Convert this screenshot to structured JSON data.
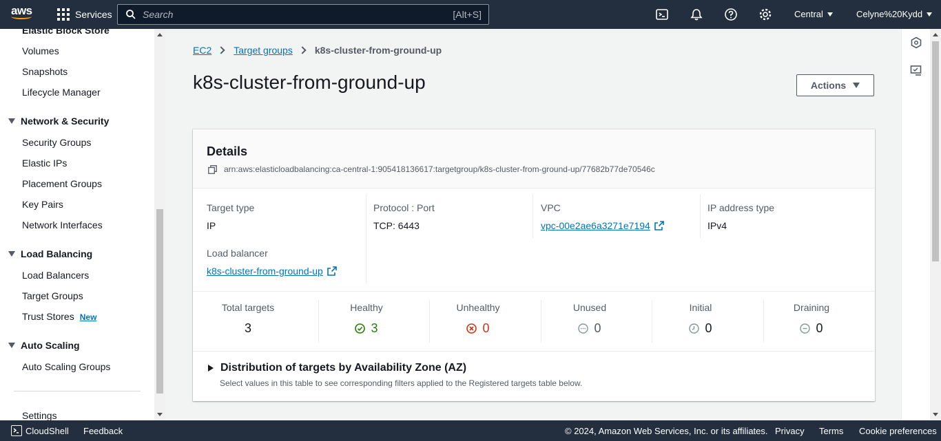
{
  "topnav": {
    "logo_text": "aws",
    "services_label": "Services",
    "search_placeholder": "Search",
    "search_shortcut": "[Alt+S]",
    "region": "Central",
    "user": "Celyne%20Kydd",
    "icons": [
      "cloudshell-icon",
      "bell-icon",
      "help-icon",
      "gear-icon"
    ]
  },
  "sidebar": {
    "partial_header": "Elastic Block Store",
    "ebs_items": [
      "Volumes",
      "Snapshots",
      "Lifecycle Manager"
    ],
    "network_section": "Network & Security",
    "network_items": [
      "Security Groups",
      "Elastic IPs",
      "Placement Groups",
      "Key Pairs",
      "Network Interfaces"
    ],
    "lb_section": "Load Balancing",
    "lb_items": [
      "Load Balancers",
      "Target Groups",
      "Trust Stores"
    ],
    "new_badge": "New",
    "as_section": "Auto Scaling",
    "as_items": [
      "Auto Scaling Groups"
    ],
    "settings": "Settings"
  },
  "breadcrumb": {
    "items": [
      "EC2",
      "Target groups"
    ],
    "current": "k8s-cluster-from-ground-up"
  },
  "page": {
    "title": "k8s-cluster-from-ground-up",
    "actions_label": "Actions"
  },
  "details": {
    "title": "Details",
    "arn": "arn:aws:elasticloadbalancing:ca-central-1:905418136617:targetgroup/k8s-cluster-from-ground-up/77682b77de70546c",
    "target_type": {
      "label": "Target type",
      "value": "IP"
    },
    "protocol_port": {
      "label": "Protocol : Port",
      "value": "TCP: 6443"
    },
    "vpc": {
      "label": "VPC",
      "value": "vpc-00e2ae6a3271e7194"
    },
    "ip_address_type": {
      "label": "IP address type",
      "value": "IPv4"
    },
    "load_balancer": {
      "label": "Load balancer",
      "value": "k8s-cluster-from-ground-up"
    }
  },
  "stats": [
    {
      "label": "Total targets",
      "value": "3"
    },
    {
      "label": "Healthy",
      "value": "3"
    },
    {
      "label": "Unhealthy",
      "value": "0"
    },
    {
      "label": "Unused",
      "value": "0"
    },
    {
      "label": "Initial",
      "value": "0"
    },
    {
      "label": "Draining",
      "value": "0"
    }
  ],
  "distribution": {
    "title": "Distribution of targets by Availability Zone (AZ)",
    "subtitle": "Select values in this table to see corresponding filters applied to the Registered targets table below."
  },
  "footer": {
    "cloudshell": "CloudShell",
    "feedback": "Feedback",
    "copyright": "© 2024, Amazon Web Services, Inc. or its affiliates.",
    "privacy": "Privacy",
    "terms": "Terms",
    "cookie": "Cookie preferences"
  },
  "colors": {
    "nav_bg": "#232f3e",
    "link": "#0073bb",
    "healthy": "#1d8102",
    "unhealthy": "#d13212",
    "aws_orange": "#ff9900"
  }
}
